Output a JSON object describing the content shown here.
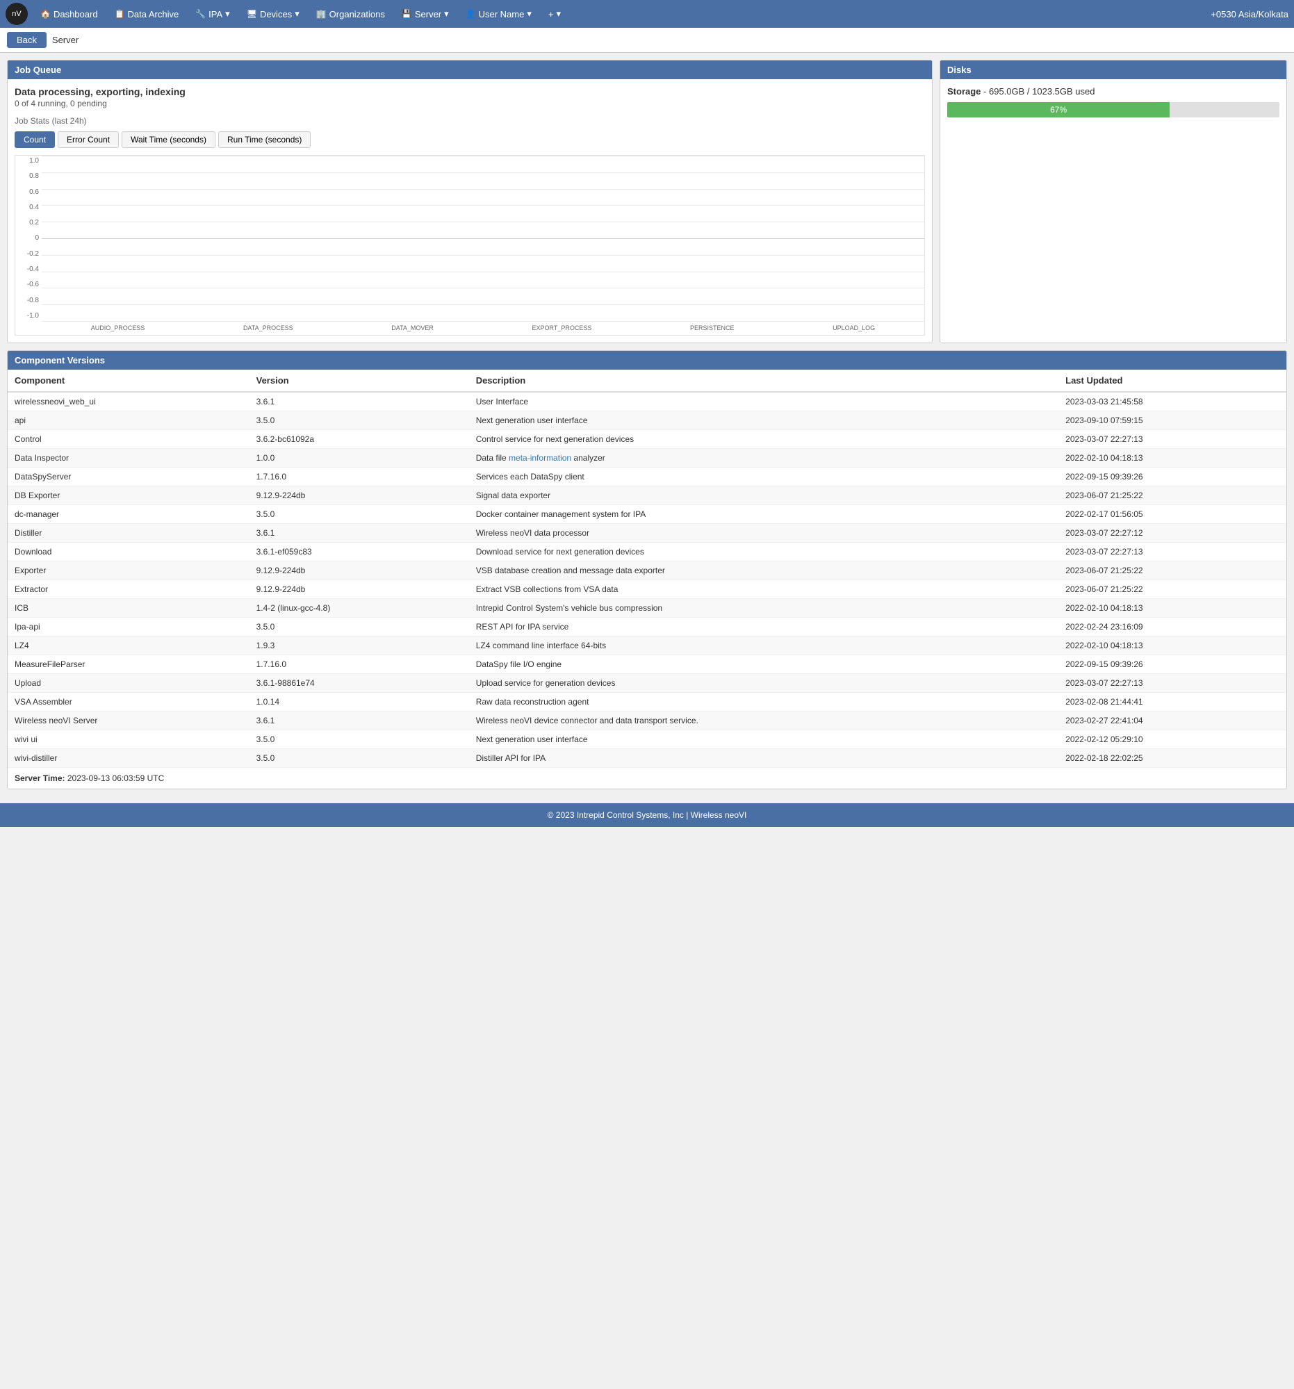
{
  "nav": {
    "logo_text": "nV",
    "items": [
      {
        "label": "Dashboard",
        "icon": "🏠",
        "name": "dashboard"
      },
      {
        "label": "Data Archive",
        "icon": "📋",
        "name": "data-archive"
      },
      {
        "label": "IPA",
        "icon": "🔧",
        "name": "ipa",
        "has_dropdown": true
      },
      {
        "label": "Devices",
        "icon": "🖥",
        "name": "devices",
        "has_dropdown": true
      },
      {
        "label": "Organizations",
        "icon": "🏢",
        "name": "organizations"
      },
      {
        "label": "Server",
        "icon": "💾",
        "name": "server",
        "has_dropdown": true
      },
      {
        "label": "User Name",
        "icon": "👤",
        "name": "user-name",
        "has_dropdown": true
      },
      {
        "label": "+",
        "icon": "",
        "name": "plus",
        "has_dropdown": true
      }
    ],
    "time": "+0530 Asia/Kolkata"
  },
  "secondary": {
    "back_label": "Back",
    "section_label": "Server"
  },
  "job_queue": {
    "panel_title": "Job Queue",
    "job_title": "Data processing, exporting, indexing",
    "job_subtitle": "0 of 4 running, 0 pending",
    "stats_label": "Job Stats",
    "stats_sublabel": "(last 24h)",
    "tabs": [
      {
        "label": "Count",
        "active": true
      },
      {
        "label": "Error Count",
        "active": false
      },
      {
        "label": "Wait Time (seconds)",
        "active": false
      },
      {
        "label": "Run Time (seconds)",
        "active": false
      }
    ],
    "chart_y_labels": [
      "1.0",
      "0.8",
      "0.6",
      "0.4",
      "0.2",
      "0",
      "-0.2",
      "-0.4",
      "-0.6",
      "-0.8",
      "-1.0"
    ],
    "chart_x_labels": [
      "AUDIO_PROCESS",
      "DATA_PROCESS",
      "DATA_MOVER",
      "EXPORT_PROCESS",
      "PERSISTENCE",
      "UPLOAD_LOG"
    ]
  },
  "disks": {
    "panel_title": "Disks",
    "storage_label": "Storage",
    "storage_used": "695.0GB / 1023.5GB used",
    "storage_percent": 67,
    "storage_percent_label": "67%"
  },
  "component_versions": {
    "panel_title": "Component Versions",
    "columns": [
      "Component",
      "Version",
      "Description",
      "Last Updated"
    ],
    "rows": [
      {
        "component": "wirelessneovi_web_ui",
        "version": "3.6.1",
        "description": "User Interface",
        "last_updated": "2023-03-03 21:45:58"
      },
      {
        "component": "api",
        "version": "3.5.0",
        "description": "Next generation user interface",
        "last_updated": "2023-09-10 07:59:15"
      },
      {
        "component": "Control",
        "version": "3.6.2-bc61092a",
        "description": "Control service for next generation devices",
        "last_updated": "2023-03-07 22:27:13"
      },
      {
        "component": "Data Inspector",
        "version": "1.0.0",
        "description": "Data file meta-information analyzer",
        "last_updated": "2022-02-10 04:18:13",
        "has_link": true,
        "link_text": "meta-information"
      },
      {
        "component": "DataSpyServer",
        "version": "1.7.16.0",
        "description": "Services each DataSpy client",
        "last_updated": "2022-09-15 09:39:26"
      },
      {
        "component": "DB Exporter",
        "version": "9.12.9-224db",
        "description": "Signal data exporter",
        "last_updated": "2023-06-07 21:25:22"
      },
      {
        "component": "dc-manager",
        "version": "3.5.0",
        "description": "Docker container management system for IPA",
        "last_updated": "2022-02-17 01:56:05"
      },
      {
        "component": "Distiller",
        "version": "3.6.1",
        "description": "Wireless neoVI data processor",
        "last_updated": "2023-03-07 22:27:12"
      },
      {
        "component": "Download",
        "version": "3.6.1-ef059c83",
        "description": "Download service for next generation devices",
        "last_updated": "2023-03-07 22:27:13"
      },
      {
        "component": "Exporter",
        "version": "9.12.9-224db",
        "description": "VSB database creation and message data exporter",
        "last_updated": "2023-06-07 21:25:22"
      },
      {
        "component": "Extractor",
        "version": "9.12.9-224db",
        "description": "Extract VSB collections from VSA data",
        "last_updated": "2023-06-07 21:25:22"
      },
      {
        "component": "ICB",
        "version": "1.4-2 (linux-gcc-4.8)",
        "description": "Intrepid Control System's vehicle bus compression",
        "last_updated": "2022-02-10 04:18:13"
      },
      {
        "component": "Ipa-api",
        "version": "3.5.0",
        "description": "REST API for IPA service",
        "last_updated": "2022-02-24 23:16:09"
      },
      {
        "component": "LZ4",
        "version": "1.9.3",
        "description": "LZ4 command line interface 64-bits",
        "last_updated": "2022-02-10 04:18:13"
      },
      {
        "component": "MeasureFileParser",
        "version": "1.7.16.0",
        "description": "DataSpy file I/O engine",
        "last_updated": "2022-09-15 09:39:26"
      },
      {
        "component": "Upload",
        "version": "3.6.1-98861e74",
        "description": "Upload service for generation devices",
        "last_updated": "2023-03-07 22:27:13"
      },
      {
        "component": "VSA Assembler",
        "version": "1.0.14",
        "description": "Raw data reconstruction agent",
        "last_updated": "2023-02-08 21:44:41"
      },
      {
        "component": "Wireless neoVI Server",
        "version": "3.6.1",
        "description": "Wireless neoVI device connector and data transport service.",
        "last_updated": "2023-02-27 22:41:04"
      },
      {
        "component": "wivi ui",
        "version": "3.5.0",
        "description": "Next generation user interface",
        "last_updated": "2022-02-12 05:29:10"
      },
      {
        "component": "wivi-distiller",
        "version": "3.5.0",
        "description": "Distiller API for IPA",
        "last_updated": "2022-02-18 22:02:25"
      }
    ]
  },
  "server_time": {
    "label": "Server Time:",
    "value": "2023-09-13 06:03:59 UTC"
  },
  "footer": {
    "text": "© 2023 Intrepid Control Systems, Inc | Wireless neoVI"
  }
}
